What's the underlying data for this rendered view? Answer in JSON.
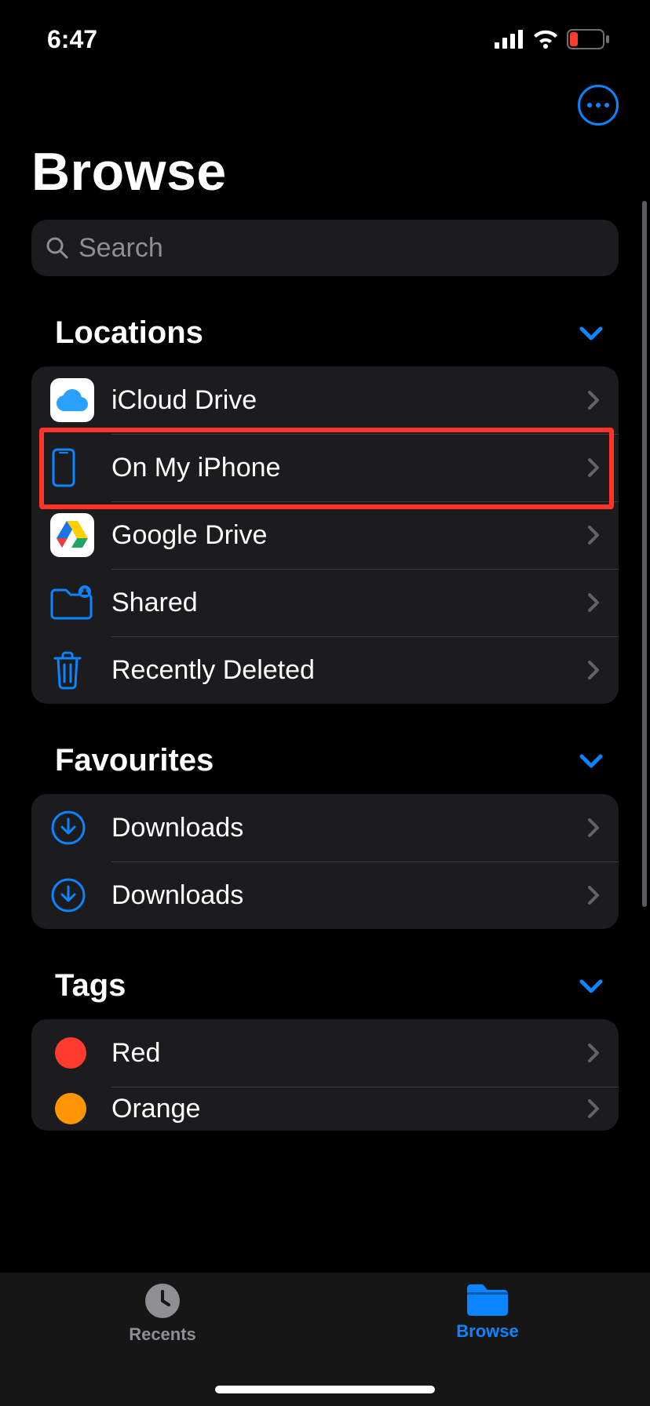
{
  "status": {
    "time": "6:47"
  },
  "colors": {
    "accent": "#0a84ff",
    "highlight": "#ff3427"
  },
  "header": {
    "title": "Browse"
  },
  "search": {
    "placeholder": "Search"
  },
  "sections": {
    "locations": {
      "title": "Locations",
      "items": [
        {
          "label": "iCloud Drive",
          "icon": "icloud",
          "highlighted": false
        },
        {
          "label": "On My iPhone",
          "icon": "iphone",
          "highlighted": true
        },
        {
          "label": "Google Drive",
          "icon": "gdrive",
          "highlighted": false
        },
        {
          "label": "Shared",
          "icon": "shared-folder",
          "highlighted": false
        },
        {
          "label": "Recently Deleted",
          "icon": "trash",
          "highlighted": false
        }
      ]
    },
    "favourites": {
      "title": "Favourites",
      "items": [
        {
          "label": "Downloads",
          "icon": "download-circle"
        },
        {
          "label": "Downloads",
          "icon": "download-circle"
        }
      ]
    },
    "tags": {
      "title": "Tags",
      "items": [
        {
          "label": "Red",
          "color": "#ff3b30"
        },
        {
          "label": "Orange",
          "color": "#ff9500"
        }
      ]
    }
  },
  "tabs": {
    "items": [
      {
        "label": "Recents",
        "icon": "clock",
        "active": false
      },
      {
        "label": "Browse",
        "icon": "folder",
        "active": true
      }
    ]
  }
}
